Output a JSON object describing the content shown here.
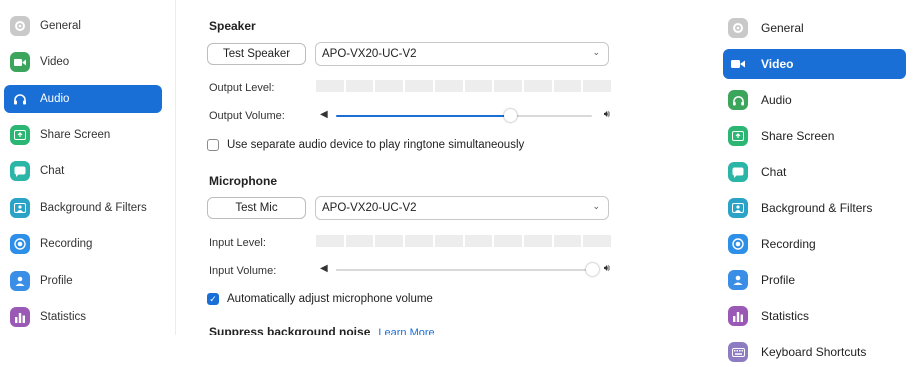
{
  "left_nav": {
    "items": [
      {
        "label": "General",
        "icon": "gear-icon",
        "color": "#9e9e9e"
      },
      {
        "label": "Video",
        "icon": "video-icon",
        "color": "#3ba55c"
      },
      {
        "label": "Audio",
        "icon": "headphones-icon",
        "color": "#1a6fd6"
      },
      {
        "label": "Share Screen",
        "icon": "share-screen-icon",
        "color": "#2bb673"
      },
      {
        "label": "Chat",
        "icon": "chat-icon",
        "color": "#2bb5a7"
      },
      {
        "label": "Background & Filters",
        "icon": "background-icon",
        "color": "#2aa3c7"
      },
      {
        "label": "Recording",
        "icon": "recording-icon",
        "color": "#2d8fe8"
      },
      {
        "label": "Profile",
        "icon": "profile-icon",
        "color": "#3a8ee6"
      },
      {
        "label": "Statistics",
        "icon": "statistics-icon",
        "color": "#9b59b6"
      }
    ],
    "active_index": 2
  },
  "speaker": {
    "title": "Speaker",
    "test_button": "Test Speaker",
    "device": "APO-VX20-UC-V2",
    "output_level_label": "Output Level:",
    "output_volume_label": "Output Volume:",
    "output_volume": 0.68,
    "separate_device_label": "Use separate audio device to play ringtone simultaneously",
    "separate_device_checked": false
  },
  "microphone": {
    "title": "Microphone",
    "test_button": "Test Mic",
    "device": "APO-VX20-UC-V2",
    "input_level_label": "Input Level:",
    "input_volume_label": "Input Volume:",
    "input_volume": 1.0,
    "auto_adjust_label": "Automatically adjust microphone volume",
    "auto_adjust_checked": true
  },
  "suppress": {
    "title": "Suppress background noise",
    "learn_more": "Learn More"
  },
  "right_nav": {
    "items": [
      {
        "label": "General",
        "icon": "gear-icon",
        "color": "#a0a0a0"
      },
      {
        "label": "Video",
        "icon": "video-icon",
        "color": "#1a6fd6"
      },
      {
        "label": "Audio",
        "icon": "headphones-icon",
        "color": "#3ba55c"
      },
      {
        "label": "Share Screen",
        "icon": "share-screen-icon",
        "color": "#2bb673"
      },
      {
        "label": "Chat",
        "icon": "chat-icon",
        "color": "#2bb5a7"
      },
      {
        "label": "Background & Filters",
        "icon": "background-icon",
        "color": "#2aa3c7"
      },
      {
        "label": "Recording",
        "icon": "recording-icon",
        "color": "#2d8fe8"
      },
      {
        "label": "Profile",
        "icon": "profile-icon",
        "color": "#3a8ee6"
      },
      {
        "label": "Statistics",
        "icon": "statistics-icon",
        "color": "#9b59b6"
      },
      {
        "label": "Keyboard Shortcuts",
        "icon": "keyboard-icon",
        "color": "#8e7cc3"
      }
    ],
    "active_index": 1
  },
  "colors": {
    "accent": "#1a6fd6"
  }
}
